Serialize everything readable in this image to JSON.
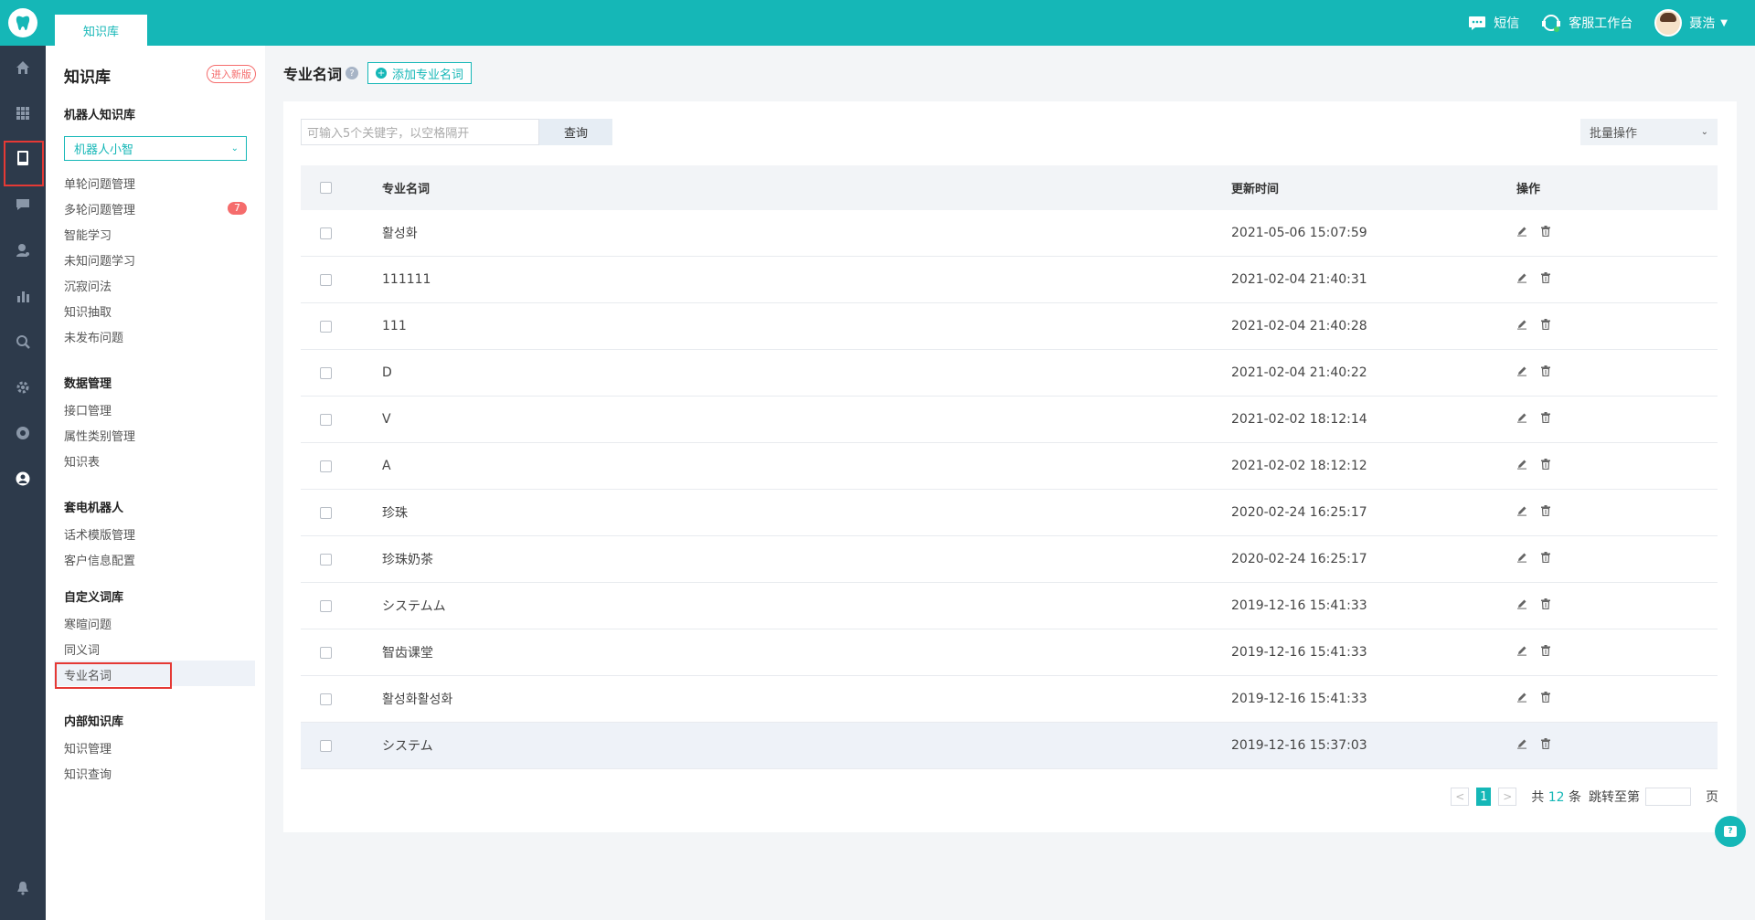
{
  "topbar": {
    "tab_label": "知识库",
    "sms_label": "短信",
    "workbench_label": "客服工作台",
    "user_name": "聂浩"
  },
  "rail": {
    "icons": [
      "home-icon",
      "apps-grid-icon",
      "book-icon",
      "chat-icon",
      "user-service-icon",
      "bar-chart-icon",
      "search-analytics-icon",
      "gear-icon",
      "eye-icon",
      "user-circle-icon",
      "bell-icon"
    ],
    "active_index": 2
  },
  "sidebar": {
    "title": "知识库",
    "new_version": "进入新版",
    "robot_group": "机器人知识库",
    "robot_select": "机器人小智",
    "robot_links": [
      "单轮问题管理",
      "多轮问题管理",
      "智能学习",
      "未知问题学习",
      "沉寂问法",
      "知识抽取",
      "未发布问题"
    ],
    "badge": "7",
    "data_group": "数据管理",
    "data_links": [
      "接口管理",
      "属性类别管理",
      "知识表"
    ],
    "call_group": "套电机器人",
    "call_links": [
      "话术模版管理",
      "客户信息配置"
    ],
    "custom_group": "自定义词库",
    "custom_links": [
      "寒暄问题",
      "同义词",
      "专业名词"
    ],
    "internal_group": "内部知识库",
    "internal_links": [
      "知识管理",
      "知识查询"
    ]
  },
  "main": {
    "title": "专业名词",
    "help": "?",
    "add_button": "添加专业名词",
    "search_placeholder": "可输入5个关键字，以空格隔开",
    "search_button": "查询",
    "batch_label": "批量操作",
    "columns": {
      "name": "专业名词",
      "time": "更新时间",
      "ops": "操作"
    },
    "rows": [
      {
        "name": "활성화",
        "time": "2021-05-06 15:07:59"
      },
      {
        "name": "111111",
        "time": "2021-02-04 21:40:31"
      },
      {
        "name": "111",
        "time": "2021-02-04 21:40:28"
      },
      {
        "name": "D",
        "time": "2021-02-04 21:40:22"
      },
      {
        "name": "V",
        "time": "2021-02-02 18:12:14"
      },
      {
        "name": "A",
        "time": "2021-02-02 18:12:12"
      },
      {
        "name": "珍珠",
        "time": "2020-02-24 16:25:17"
      },
      {
        "name": "珍珠奶茶",
        "time": "2020-02-24 16:25:17"
      },
      {
        "name": "システムム",
        "time": "2019-12-16 15:41:33"
      },
      {
        "name": "智齿课堂",
        "time": "2019-12-16 15:41:33"
      },
      {
        "name": "활성화활성화",
        "time": "2019-12-16 15:41:33"
      },
      {
        "name": "システム",
        "time": "2019-12-16 15:37:03"
      }
    ],
    "pager": {
      "prev": "<",
      "next": ">",
      "current": "1",
      "total_prefix": "共",
      "total": "12",
      "total_suffix": "条",
      "jump_label": "跳转至第",
      "page_suffix": "页"
    }
  },
  "colors": {
    "accent": "#15b7b7",
    "rail_bg": "#2d3a4b",
    "badge": "#f56c6c",
    "highlight": "#e53935"
  }
}
